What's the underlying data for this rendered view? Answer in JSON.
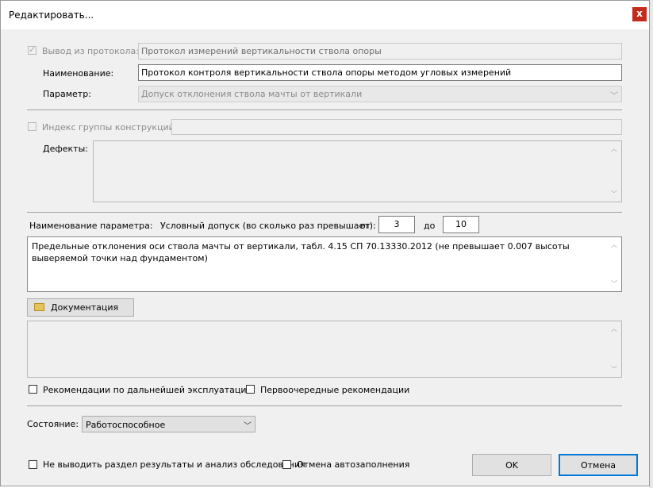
{
  "window": {
    "title": "Редактировать...",
    "close_glyph": "x"
  },
  "protocol": {
    "output_label": "Вывод из протокола:",
    "output_value": "Протокол измерений вертикальности ствола опоры",
    "name_label": "Наименование:",
    "name_value": "Протокол контроля вертикальности ствола опоры методом угловых измерений",
    "param_label": "Параметр:",
    "param_value": "Допуск отклонения ствола мачты от вертикали"
  },
  "group": {
    "index_label": "Индекс группы конструкций:",
    "index_value": "",
    "defects_label": "Дефекты:"
  },
  "parameter": {
    "name_label": "Наименование параметра:",
    "tolerance_label": "Условный допуск (во сколько раз превышает):",
    "from_label": "от",
    "from_value": "3",
    "to_label": "до",
    "to_value": "10",
    "description": "Предельные отклонения оси ствола мачты от вертикали, табл. 4.15 СП 70.13330.2012 (не превышает 0.007 высоты выверяемой точки над фундаментом)"
  },
  "documentation": {
    "button_label": "Документация"
  },
  "recommendations": {
    "further_label": "Рекомендации по дальнейшей эксплуатации",
    "priority_label": "Первоочередные рекомендации"
  },
  "state": {
    "label": "Состояние:",
    "value": "Работоспособное"
  },
  "footer": {
    "no_results_label": "Не выводить раздел результаты и анализ обследования",
    "cancel_autofill_label": "Отмена автозаполнения",
    "ok_label": "OK",
    "cancel_label": "Отмена"
  },
  "colors": {
    "close_button": "#c42b1c",
    "default_button_border": "#0078d7",
    "dialog_bg": "#f0f0f0"
  }
}
